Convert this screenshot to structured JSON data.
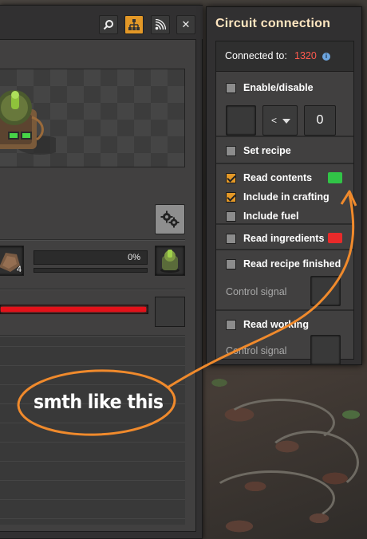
{
  "entity_window": {
    "titlebar": {
      "search_icon": "search-icon",
      "network_icon": "network-icon",
      "signal_icon": "signal-icon",
      "close_icon": "close-icon",
      "close_glyph": "✕",
      "search_glyph": "⌕"
    },
    "input_slot": {
      "count": "4"
    },
    "progress": {
      "value": "0%",
      "fraction": 0.0
    },
    "power": {
      "fill_fraction": 0.99
    }
  },
  "circuit_panel": {
    "title": "Circuit connection",
    "connected_label": "Connected to:",
    "connected_value": "1320",
    "info_glyph": "i",
    "enable_disable": {
      "label": "Enable/disable",
      "checked": false,
      "operator": "<",
      "constant": "0"
    },
    "set_recipe": {
      "label": "Set recipe",
      "checked": false
    },
    "read_contents": {
      "label": "Read contents",
      "checked": true,
      "wire_color": "#31c447"
    },
    "include_in_crafting": {
      "label": "Include in crafting",
      "checked": true
    },
    "include_fuel": {
      "label": "Include fuel",
      "checked": false
    },
    "read_ingredients": {
      "label": "Read ingredients",
      "checked": false,
      "wire_color": "#e82a2a"
    },
    "read_recipe_finished": {
      "label": "Read recipe finished",
      "checked": false,
      "control_label": "Control signal"
    },
    "read_working": {
      "label": "Read working",
      "checked": false,
      "control_label": "Control signal"
    }
  },
  "annotation": {
    "text": "smth like this",
    "color": "#f08a2c"
  },
  "colors": {
    "accent": "#e39827",
    "panel_bg": "#313031",
    "inner_bg": "#414040",
    "alert_red": "#e3121a"
  }
}
